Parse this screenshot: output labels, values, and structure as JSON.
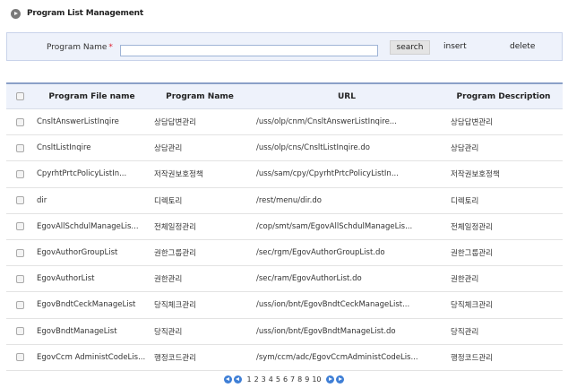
{
  "page": {
    "title": "Program List Management"
  },
  "search": {
    "label": "Program Name",
    "required_mark": "*",
    "value": "",
    "search_label": "search",
    "insert_label": "insert",
    "delete_label": "delete"
  },
  "table": {
    "headers": [
      "Program File name",
      "Program Name",
      "URL",
      "Program Description"
    ],
    "rows": [
      {
        "file": "CnsltAnswerListInqire",
        "name": "상담답변관리",
        "url": "/uss/olp/cnm/CnsltAnswerListInqire...",
        "desc": "상담답변관리"
      },
      {
        "file": "CnsltListInqire",
        "name": "상담관리",
        "url": "/uss/olp/cns/CnsltListInqire.do",
        "desc": "상담관리"
      },
      {
        "file": "CpyrhtPrtcPolicyListIn...",
        "name": "저작권보호정책",
        "url": "/uss/sam/cpy/CpyrhtPrtcPolicyListIn...",
        "desc": "저작권보호정책"
      },
      {
        "file": "dir",
        "name": "디렉토리",
        "url": "/rest/menu/dir.do",
        "desc": "디렉토리"
      },
      {
        "file": "EgovAllSchdulManageLis...",
        "name": "전체일정관리",
        "url": "/cop/smt/sam/EgovAllSchdulManageLis...",
        "desc": "전체일정관리"
      },
      {
        "file": "EgovAuthorGroupList",
        "name": "권한그룹관리",
        "url": "/sec/rgm/EgovAuthorGroupList.do",
        "desc": "권한그룹관리"
      },
      {
        "file": "EgovAuthorList",
        "name": "권한관리",
        "url": "/sec/ram/EgovAuthorList.do",
        "desc": "권한관리"
      },
      {
        "file": "EgovBndtCeckManageList",
        "name": "당직체크관리",
        "url": "/uss/ion/bnt/EgovBndtCeckManageList...",
        "desc": "당직체크관리"
      },
      {
        "file": "EgovBndtManageList",
        "name": "당직관리",
        "url": "/uss/ion/bnt/EgovBndtManageList.do",
        "desc": "당직관리"
      },
      {
        "file": "EgovCcm AdministCodeLis...",
        "name": "행정코드관리",
        "url": "/sym/ccm/adc/EgovCcmAdministCodeLis...",
        "desc": "행정코드관리"
      }
    ]
  },
  "pagination": {
    "pages": [
      "1",
      "2",
      "3",
      "4",
      "5",
      "6",
      "7",
      "8",
      "9",
      "10"
    ]
  }
}
